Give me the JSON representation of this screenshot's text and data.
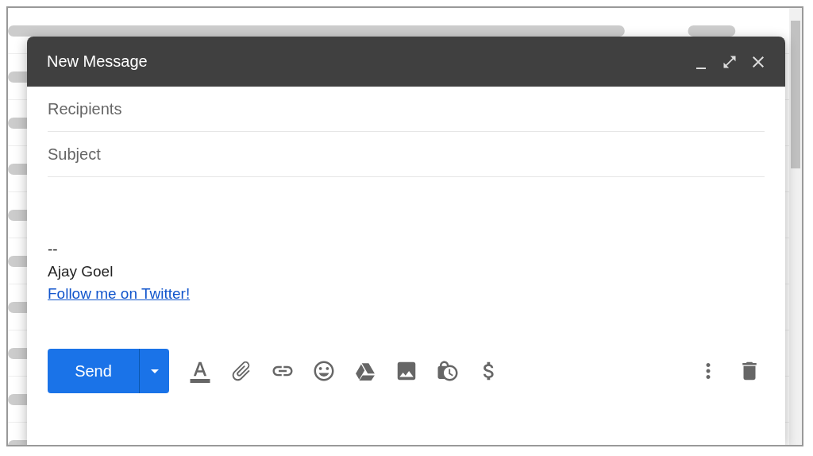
{
  "window": {
    "title": "New Message"
  },
  "fields": [
    {
      "placeholder": "Recipients"
    },
    {
      "placeholder": "Subject"
    }
  ],
  "body": [
    {
      "kind": "text",
      "text": "--"
    },
    {
      "kind": "text",
      "text": "Ajay Goel"
    },
    {
      "kind": "link",
      "text": "Follow me on Twitter!"
    }
  ],
  "send_button": {
    "label": "Send"
  }
}
